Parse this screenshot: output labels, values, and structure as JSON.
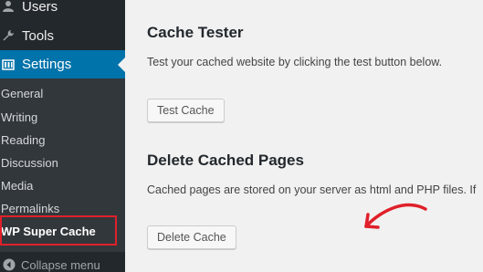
{
  "sidebar": {
    "users_label": "Users",
    "tools_label": "Tools",
    "settings_label": "Settings",
    "submenu": {
      "general": "General",
      "writing": "Writing",
      "reading": "Reading",
      "discussion": "Discussion",
      "media": "Media",
      "permalinks": "Permalinks",
      "wp_super_cache": "WP Super Cache"
    },
    "collapse_label": "Collapse menu"
  },
  "main": {
    "cache_tester": {
      "title": "Cache Tester",
      "description": "Test your cached website by clicking the test button below.",
      "button_label": "Test Cache"
    },
    "delete_cached": {
      "title": "Delete Cached Pages",
      "description": "Cached pages are stored on your server as html and PHP files. If",
      "button_label": "Delete Cache"
    }
  },
  "colors": {
    "sidebar_bg": "#23282d",
    "submenu_bg": "#32373c",
    "active_blue": "#0073aa",
    "highlight_red": "#e0202a",
    "content_bg": "#f1f1f1"
  },
  "icons": [
    "users-icon",
    "wrench-icon",
    "settings-icon",
    "collapse-icon",
    "hand-drawn-arrow-icon"
  ]
}
